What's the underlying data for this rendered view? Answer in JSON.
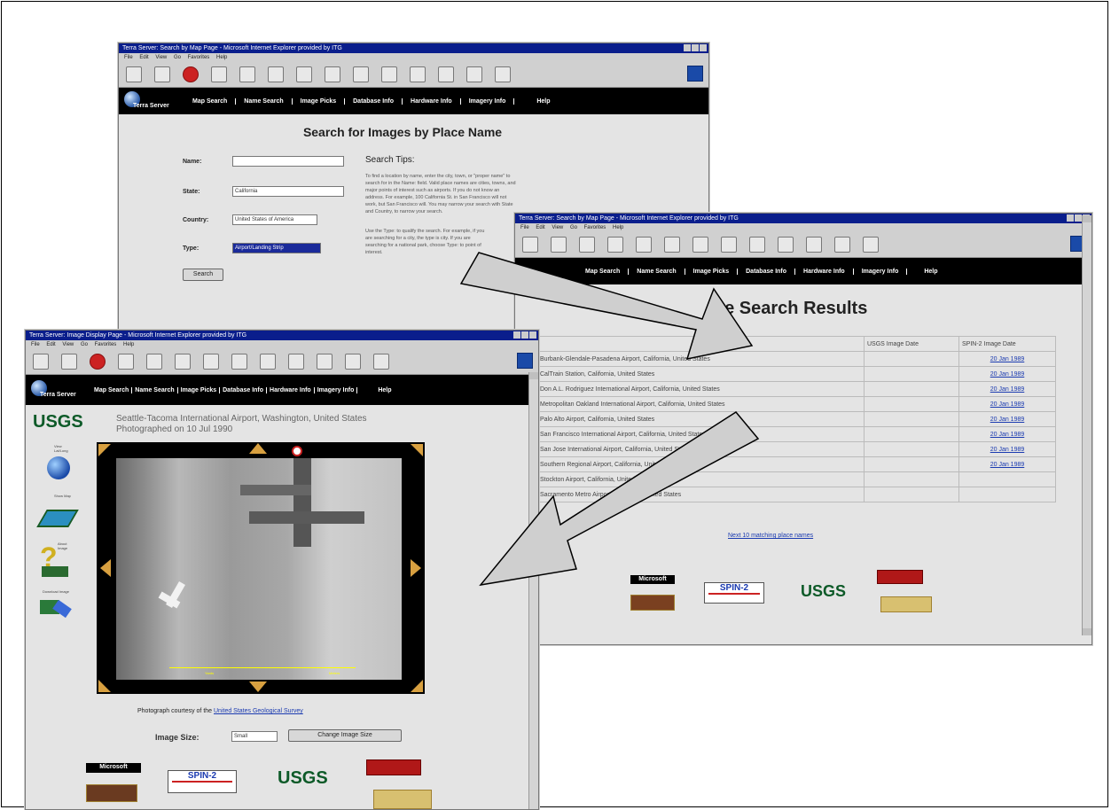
{
  "search_window": {
    "title": "Terra Server: Search by Map Page - Microsoft Internet Explorer provided by ITG",
    "menu": [
      "File",
      "Edit",
      "View",
      "Go",
      "Favorites",
      "Help"
    ],
    "nav": [
      "Map Search",
      "Name Search",
      "Image Picks",
      "Database Info",
      "Hardware Info",
      "Imagery Info",
      "Help"
    ],
    "logo_text": "Terra Server",
    "page_title": "Search for Images by Place Name",
    "form": {
      "name_label": "Name:",
      "name_value": "",
      "state_label": "State:",
      "state_value": "California",
      "country_label": "Country:",
      "country_value": "United States of America",
      "type_label": "Type:",
      "type_value": "Airport/Landing Strip",
      "search_button": "Search"
    },
    "tips_title": "Search Tips:",
    "tips_text_1": "To find a location by name, enter the city, town, or \"proper name\" to search for in the Name: field. Valid place names are cities, towns, and major points of interest such as airports. If you do not know an address. For example, 100 California St. in San Francisco will not work, but San Francisco will. You may narrow your search with State and Country, to narrow your search.",
    "tips_text_2": "Use the Type: to qualify the search. For example, if you are searching for a city, the type is city. If you are searching for a national park, choose Type: to point of interest."
  },
  "results_window": {
    "title": "Terra Server: Search by Map Page - Microsoft Internet Explorer provided by ITG",
    "menu": [
      "File",
      "Edit",
      "View",
      "Go",
      "Favorites",
      "Help"
    ],
    "nav": [
      "Map Search",
      "Name Search",
      "Image Picks",
      "Database Info",
      "Hardware Info",
      "Imagery Info",
      "Help"
    ],
    "page_title": "ce Search Results",
    "headers": [
      "",
      "USGS Image Date",
      "SPIN-2 Image Date"
    ],
    "rows": [
      {
        "place": "Burbank-Glendale-Pasadena Airport, California, United States",
        "usgs": "",
        "spin": "20 Jan 1989"
      },
      {
        "place": "CalTrain Station, California, United States",
        "usgs": "",
        "spin": "20 Jan 1989"
      },
      {
        "place": "Don A.L. Rodriguez International Airport, California, United States",
        "usgs": "",
        "spin": "20 Jan 1989"
      },
      {
        "place": "Metropolitan Oakland International Airport, California, United States",
        "usgs": "",
        "spin": "20 Jan 1989"
      },
      {
        "place": "Palo Alto Airport, California, United States",
        "usgs": "",
        "spin": "20 Jan 1989"
      },
      {
        "place": "San Francisco International Airport, California, United States",
        "usgs": "",
        "spin": "20 Jan 1989"
      },
      {
        "place": "San Jose International Airport, California, United States",
        "usgs": "",
        "spin": "20 Jan 1989"
      },
      {
        "place": "Southern Regional Airport, California, United States",
        "usgs": "",
        "spin": "20 Jan 1989"
      },
      {
        "place": "Stockton Airport, California, United States",
        "usgs": "",
        "spin": ""
      },
      {
        "place": "Sacramento Metro Airport, California, United States",
        "usgs": "",
        "spin": ""
      }
    ],
    "next_link": "Next 10 matching place names"
  },
  "image_window": {
    "title": "Terra Server: Image Display Page - Microsoft Internet Explorer provided by ITG",
    "menu": [
      "File",
      "Edit",
      "View",
      "Go",
      "Favorites",
      "Help"
    ],
    "nav": [
      "Map Search",
      "Name Search",
      "Image Picks",
      "Database Info",
      "Hardware Info",
      "Imagery Info",
      "Help"
    ],
    "usgs_label": "USGS",
    "place_line": "Seattle-Tacoma International Airport, Washington, United States",
    "photo_date": "Photographed on 10 Jul 1990",
    "scale_left": "Yards",
    "scale_right": "Meters",
    "credit_prefix": "Photograph courtesy of the ",
    "credit_link": "United States Geological Survey",
    "image_size_label": "Image Size:",
    "image_size_value": "Small",
    "change_button": "Change Image Size",
    "sidebar_labels": [
      "View Lat/Long",
      "Show Map",
      "About Image",
      "Download Image"
    ]
  },
  "logos": {
    "microsoft": "Microsoft",
    "spin2": "SPIN-2",
    "usgs": "USGS"
  }
}
